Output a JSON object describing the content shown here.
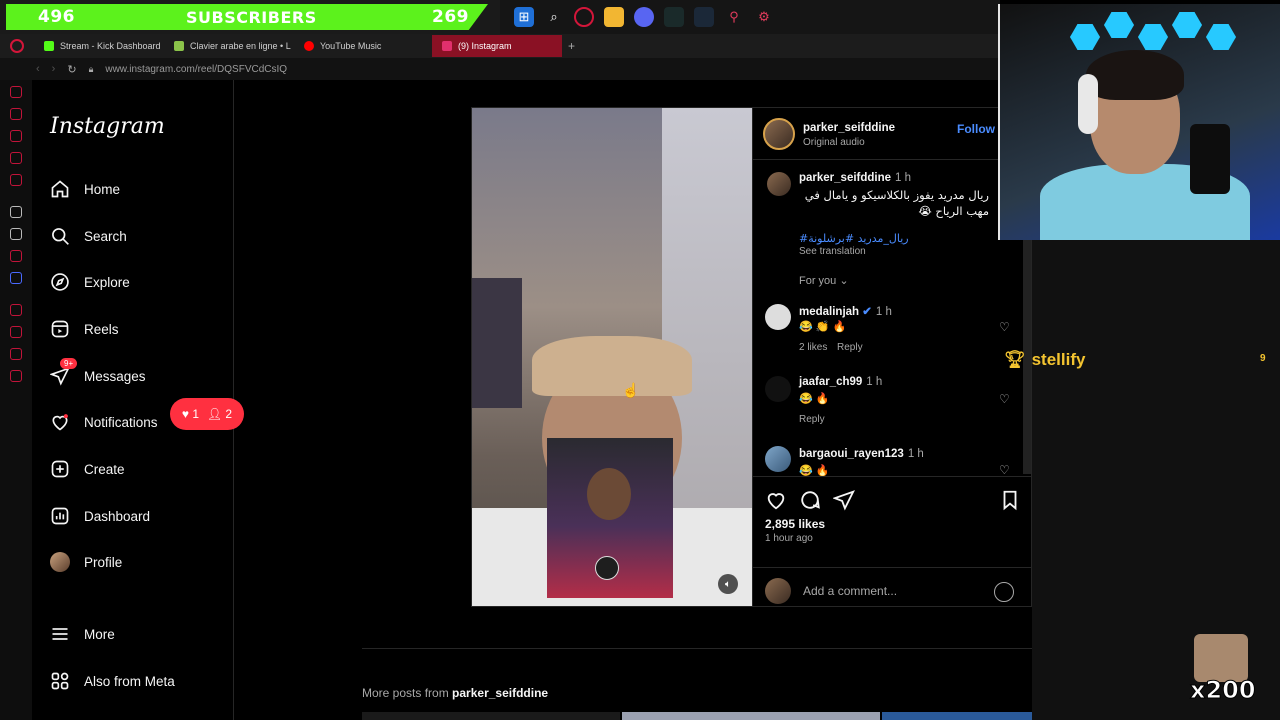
{
  "overlay": {
    "subscribers_left": "496",
    "subscribers_label": "SUBSCRIBERS",
    "subscribers_right": "269",
    "stellify_label": "stellify",
    "stellify_count": "9",
    "multiplier": "x200"
  },
  "browser": {
    "tabs": [
      {
        "label": "Stream - Kick Dashboard",
        "color": "#53fc18"
      },
      {
        "label": "Clavier arabe en ligne • L",
        "color": "#8bc34a"
      },
      {
        "label": "YouTube Music",
        "color": "#ff0000"
      },
      {
        "label": "(9) Instagram",
        "color": "#e1306c"
      }
    ],
    "url": "www.instagram.com/reel/DQSFVCdCsIQ"
  },
  "instagram": {
    "logo": "Instagram",
    "nav": {
      "home": "Home",
      "search": "Search",
      "explore": "Explore",
      "reels": "Reels",
      "messages": "Messages",
      "messages_badge": "9+",
      "notifications": "Notifications",
      "notif_likes": "1",
      "notif_follows": "2",
      "create": "Create",
      "dashboard": "Dashboard",
      "profile": "Profile",
      "more": "More",
      "also_from_meta": "Also from Meta"
    },
    "post": {
      "author": "parker_seifddine",
      "audio": "Original audio",
      "follow": "Follow",
      "caption_author": "parker_seifddine",
      "caption_time": "1 h",
      "caption": "ريال مدريد يفوز بالكلاسيكو و يامال في مهب الرياح 😭",
      "hashtags": "#ريال_مدريد #برشلونة",
      "see_translation": "See translation",
      "for_you": "For you",
      "comments": [
        {
          "user": "medalinjah",
          "time": "1 h",
          "text": "😂 👏 🔥",
          "likes": "2 likes",
          "reply": "Reply"
        },
        {
          "user": "jaafar_ch99",
          "time": "1 h",
          "text": "😂 🔥",
          "likes": "",
          "reply": "Reply"
        },
        {
          "user": "bargaoui_rayen123",
          "time": "1 h",
          "text": "😂 🔥",
          "likes": "",
          "reply": ""
        }
      ],
      "likes_count": "2,895 likes",
      "posted_ago": "1 hour ago",
      "add_comment_placeholder": "Add a comment..."
    },
    "more_posts_prefix": "More posts from",
    "more_posts_user": "parker_seifddine"
  }
}
